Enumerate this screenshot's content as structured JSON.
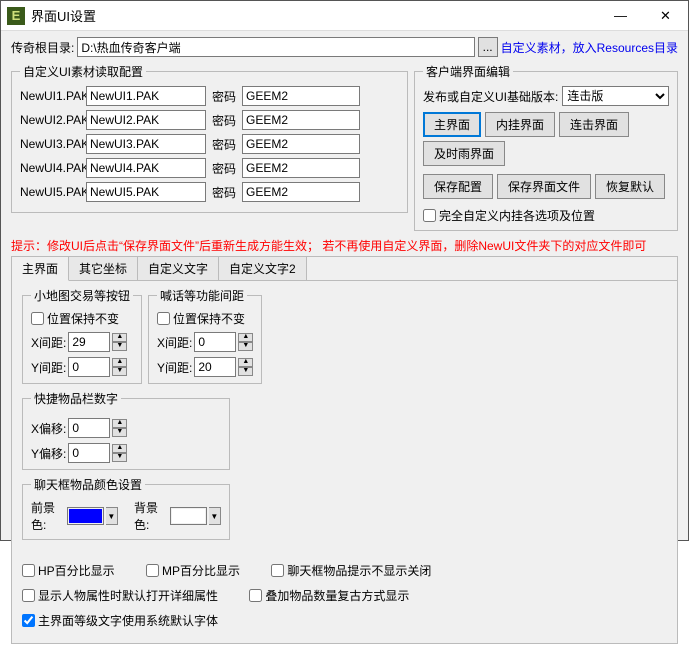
{
  "title": "界面UI设置",
  "root_dir_label": "传奇根目录:",
  "root_dir": "D:\\热血传奇客户端",
  "custom_hint": "自定义素材，放入Resources目录",
  "left_legend": "自定义UI素材读取配置",
  "pak_pwd_label": "密码",
  "paks": [
    {
      "label": "NewUI1.PAK",
      "name": "NewUI1.PAK",
      "pwd": "GEEM2"
    },
    {
      "label": "NewUI2.PAK",
      "name": "NewUI2.PAK",
      "pwd": "GEEM2"
    },
    {
      "label": "NewUI3.PAK",
      "name": "NewUI3.PAK",
      "pwd": "GEEM2"
    },
    {
      "label": "NewUI4.PAK",
      "name": "NewUI4.PAK",
      "pwd": "GEEM2"
    },
    {
      "label": "NewUI5.PAK",
      "name": "NewUI5.PAK",
      "pwd": "GEEM2"
    }
  ],
  "right_legend": "客户端界面编辑",
  "base_label": "发布或自定义UI基础版本:",
  "base_sel": "连击版",
  "ui_buttons": [
    "主界面",
    "内挂界面",
    "连击界面",
    "及时雨界面"
  ],
  "cfg_buttons": [
    "保存配置",
    "保存界面文件",
    "恢复默认"
  ],
  "full_custom": "完全自定义内挂各选项及位置",
  "hint_text": "提示：修改UI后点击“保存界面文件”后重新生成方能生效；  若不再使用自定义界面，删除NewUI文件夹下的对应文件即可",
  "tabs": [
    "主界面",
    "其它坐标",
    "自定义文字",
    "自定义文字2"
  ],
  "g1_legend": "小地图交易等按钮",
  "g2_legend": "喊话等功能间距",
  "keep_pos": "位置保持不变",
  "xgap": "X间距:",
  "ygap": "Y间距:",
  "g1_x": "29",
  "g1_y": "0",
  "g2_x": "0",
  "g2_y": "20",
  "g3_legend": "快捷物品栏数字",
  "xoff": "X偏移:",
  "yoff": "Y偏移:",
  "g3_x": "0",
  "g3_y": "0",
  "g4_legend": "聊天框物品颜色设置",
  "fg": "前景色:",
  "bg": "背景色:",
  "fg_color": "#0000ff",
  "bg_color": "#ffffff",
  "checks": {
    "hp": "HP百分比显示",
    "mp": "MP百分比显示",
    "chat_tip": "聊天框物品提示不显示关闭",
    "attr": "显示人物属性时默认打开详细属性",
    "stack": "叠加物品数量复古方式显示",
    "font": "主界面等级文字使用系统默认字体"
  }
}
